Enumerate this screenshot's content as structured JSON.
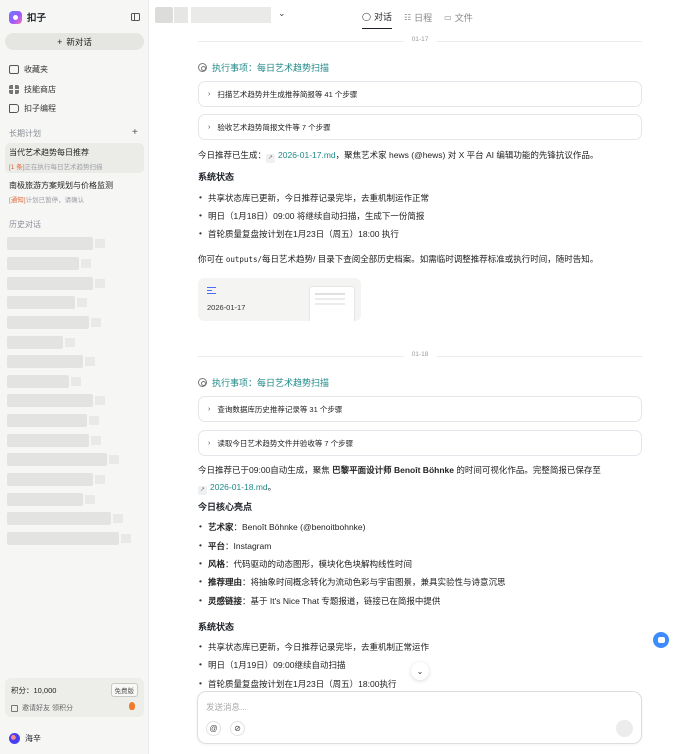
{
  "sidebar": {
    "brand": "扣子",
    "new_chat": "新对话",
    "nav": [
      "收藏夹",
      "技能商店",
      "扣子编程"
    ],
    "long_plan_title": "长期计划",
    "tasks": [
      {
        "title": "当代艺术趋势每日推荐",
        "tag": "[1 条]",
        "sub": "正在执行每日艺术趋势扫描"
      },
      {
        "title": "南极旅游方案规划与价格监测",
        "tag": "[通知]",
        "sub": "计划已暂停，请确认"
      }
    ],
    "history_title": "历史对话",
    "credit_label": "积分：10,000",
    "credit_badge": "免费版",
    "invite": "邀请好友 领积分",
    "user": "海辛"
  },
  "topbar": {
    "tabs": [
      {
        "icon": "chat-icon",
        "label": "对话"
      },
      {
        "icon": "schedule-icon",
        "label": "日程"
      },
      {
        "icon": "folder-icon",
        "label": "文件"
      }
    ]
  },
  "day1": {
    "date": "01-17",
    "exec": "执行事项：每日艺术趋势扫描",
    "steps": [
      "扫描艺术趋势并生成推荐简报等 41 个步骤",
      "验收艺术趋势简报文件等 7 个步骤"
    ],
    "rec_prefix": "今日推荐已生成：",
    "rec_link": "2026-01-17.md",
    "rec_suffix": "，聚焦艺术家 hews (@hews) 对 X 平台 AI 编辑功能的先锋抗议作品。",
    "status_title": "系统状态",
    "status": [
      "共享状态库已更新，今日推荐记录完毕，去重机制运作正常",
      "明日（1月18日）09:00 将继续自动扫描，生成下一份简报",
      "首轮质量复盘按计划在1月23日（周五）18:00 执行"
    ],
    "note_a": "你可在 ",
    "note_code": "outputs/",
    "note_b": "每日艺术趋势/ 目录下查阅全部历史档案。如需临时调整推荐标准或执行时间，随时告知。",
    "file_name": "2026-01-17"
  },
  "day2": {
    "date": "01-18",
    "exec": "执行事项：每日艺术趋势扫描",
    "steps": [
      "查询数据库历史推荐记录等 31 个步骤",
      "读取今日艺术趋势文件并验收等 7 个步骤"
    ],
    "rec_prefix": "今日推荐已于09:00自动生成，聚焦 ",
    "rec_bold": "巴黎平面设计师 Benoît Böhnke",
    "rec_suffix": " 的时间可视化作品。完整简报已保存至",
    "rec_link": "2026-01-18.md",
    "rec_end": "。",
    "core_title": "今日核心亮点",
    "core": [
      {
        "k": "艺术家",
        "v": "：Benoît Böhnke (@benoitbohnke)"
      },
      {
        "k": "平台",
        "v": "：Instagram"
      },
      {
        "k": "风格",
        "v": "：代码驱动的动态图形，模块化色块解构线性时间"
      },
      {
        "k": "推荐理由",
        "v": "：将抽象时间概念转化为流动色彩与宇宙图景，兼具实验性与诗意沉思"
      },
      {
        "k": "灵感链接",
        "v": "：基于 It's Nice That 专题报道，链接已在简报中提供"
      }
    ],
    "status_title": "系统状态",
    "status": [
      "共享状态库已更新，今日推荐记录完毕，去重机制正常运作",
      "明日（1月19日）09:00继续自动扫描",
      "首轮质量复盘按计划在1月23日（周五）18:00执行"
    ]
  },
  "composer": {
    "placeholder": "发送消息..."
  }
}
